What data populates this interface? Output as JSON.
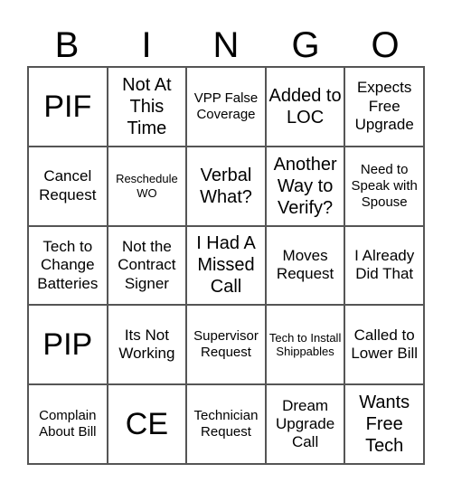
{
  "header": [
    "B",
    "I",
    "N",
    "G",
    "O"
  ],
  "cells": [
    [
      "PIF",
      "Not At This Time",
      "VPP False Coverage",
      "Added to LOC",
      "Expects Free Upgrade"
    ],
    [
      "Cancel Request",
      "Reschedule WO",
      "Verbal What?",
      "Another Way to Verify?",
      "Need to Speak with Spouse"
    ],
    [
      "Tech to Change Batteries",
      "Not the Contract Signer",
      "I Had A Missed Call",
      "Moves Request",
      "I Already Did That"
    ],
    [
      "PIP",
      "Its Not Working",
      "Supervisor Request",
      "Tech to Install Shippables",
      "Called to Lower Bill"
    ],
    [
      "Complain About Bill",
      "CE",
      "Technician Request",
      "Dream Upgrade Call",
      "Wants Free Tech"
    ]
  ]
}
